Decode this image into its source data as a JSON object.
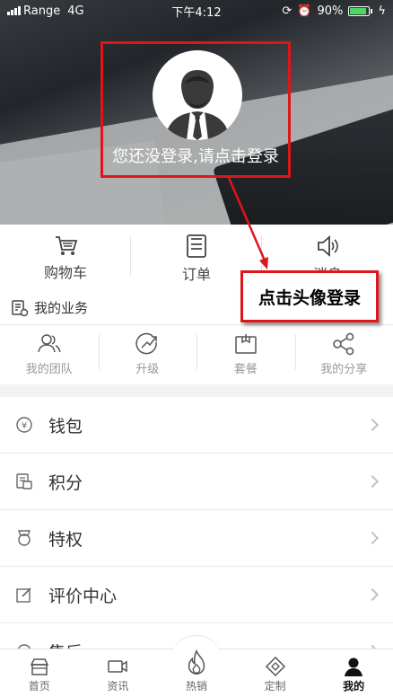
{
  "status": {
    "carrier": "Range",
    "network": "4G",
    "time": "下午4:12",
    "battery": "90%",
    "battery_level": 0.9
  },
  "hero": {
    "login_prompt": "您还没登录,请点击登录"
  },
  "quick": [
    {
      "label": "购物车",
      "icon": "cart-icon"
    },
    {
      "label": "订单",
      "icon": "order-icon"
    },
    {
      "label": "消息",
      "icon": "speaker-icon"
    }
  ],
  "business": {
    "label": "我的业务"
  },
  "team": [
    {
      "label": "我的团队",
      "icon": "team-icon"
    },
    {
      "label": "升级",
      "icon": "upgrade-icon"
    },
    {
      "label": "套餐",
      "icon": "package-icon"
    },
    {
      "label": "我的分享",
      "icon": "share-icon"
    }
  ],
  "menu": [
    {
      "label": "钱包",
      "icon": "wallet-icon"
    },
    {
      "label": "积分",
      "icon": "points-icon"
    },
    {
      "label": "特权",
      "icon": "privilege-icon"
    },
    {
      "label": "评价中心",
      "icon": "review-icon"
    },
    {
      "label": "售后",
      "icon": "aftersale-icon"
    }
  ],
  "annotation": {
    "text": "点击头像登录"
  },
  "tabs": [
    {
      "label": "首页",
      "icon": "home-icon"
    },
    {
      "label": "资讯",
      "icon": "video-icon"
    },
    {
      "label": "热销",
      "icon": "flame-icon"
    },
    {
      "label": "定制",
      "icon": "custom-icon"
    },
    {
      "label": "我的",
      "icon": "user-icon"
    }
  ],
  "colors": {
    "annotation_red": "#e0151b",
    "battery_green": "#4cd964"
  }
}
